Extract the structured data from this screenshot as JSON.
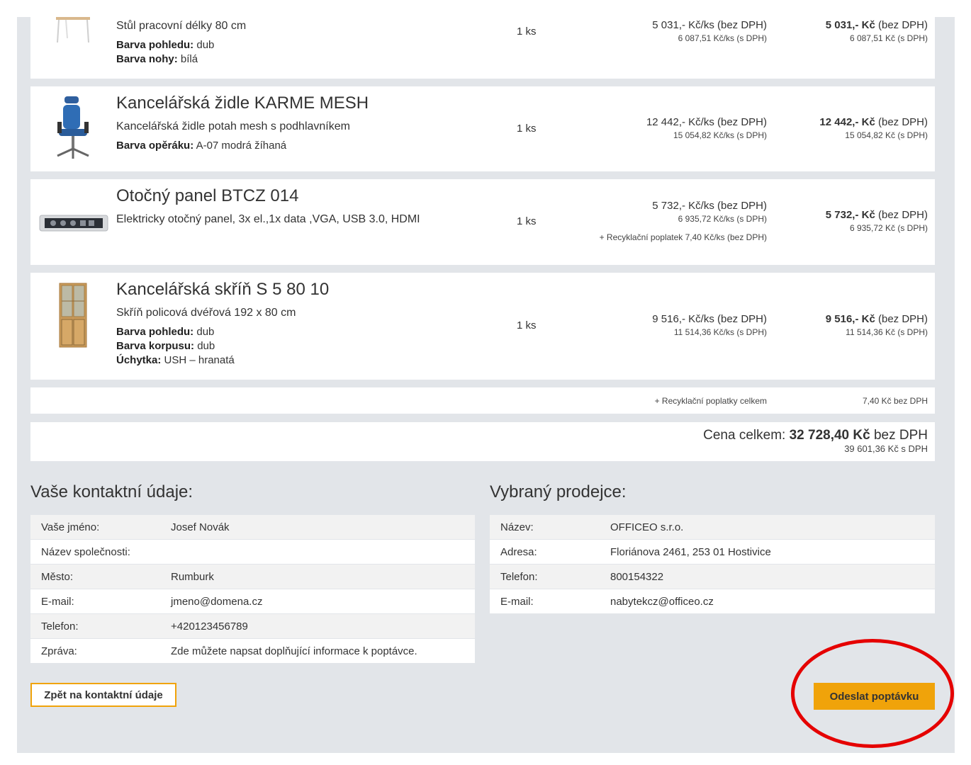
{
  "products": [
    {
      "title": "",
      "desc": "Stůl pracovní délky 80 cm",
      "attrs": [
        {
          "label": "Barva pohledu:",
          "value": "dub"
        },
        {
          "label": "Barva nohy:",
          "value": "bílá"
        }
      ],
      "qty": "1 ks",
      "unit_price": "5 031,- Kč/ks (bez DPH)",
      "unit_price_vat": "6 087,51 Kč/ks (s DPH)",
      "total_bold": "5 031,- Kč",
      "total_suffix": " (bez DPH)",
      "total_vat": "6 087,51 Kč (s DPH)"
    },
    {
      "title": "Kancelářská židle KARME MESH",
      "desc": "Kancelářská židle potah mesh s podhlavníkem",
      "attrs": [
        {
          "label": "Barva opěráku:",
          "value": "A-07 modrá žíhaná"
        }
      ],
      "qty": "1 ks",
      "unit_price": "12 442,- Kč/ks (bez DPH)",
      "unit_price_vat": "15 054,82 Kč/ks (s DPH)",
      "total_bold": "12 442,- Kč",
      "total_suffix": " (bez DPH)",
      "total_vat": "15 054,82 Kč (s DPH)"
    },
    {
      "title": "Otočný panel BTCZ 014",
      "desc": "Elektricky otočný panel, 3x el.,1x data ,VGA, USB 3.0, HDMI",
      "attrs": [],
      "qty": "1 ks",
      "unit_price": "5 732,- Kč/ks (bez DPH)",
      "unit_price_vat": "6 935,72 Kč/ks (s DPH)",
      "recycling": "+ Recyklační poplatek 7,40 Kč/ks (bez DPH)",
      "total_bold": "5 732,- Kč",
      "total_suffix": " (bez DPH)",
      "total_vat": "6 935,72 Kč (s DPH)"
    },
    {
      "title": "Kancelářská skříň S 5 80 10",
      "desc": "Skříň policová dvéřová 192 x 80 cm",
      "attrs": [
        {
          "label": "Barva pohledu:",
          "value": "dub"
        },
        {
          "label": "Barva korpusu:",
          "value": "dub"
        },
        {
          "label": "Úchytka:",
          "value": "USH – hranatá"
        }
      ],
      "qty": "1 ks",
      "unit_price": "9 516,- Kč/ks (bez DPH)",
      "unit_price_vat": "11 514,36 Kč/ks (s DPH)",
      "total_bold": "9 516,- Kč",
      "total_suffix": " (bez DPH)",
      "total_vat": "11 514,36 Kč (s DPH)"
    }
  ],
  "recycling_total": {
    "label": "+ Recyklační poplatky celkem",
    "value": "7,40 Kč bez DPH"
  },
  "grand_total": {
    "prefix": "Cena celkem: ",
    "bold": "32 728,40 Kč",
    "suffix": " bez DPH",
    "vat": "39 601,36 Kč s DPH"
  },
  "contact": {
    "title": "Vaše kontaktní údaje:",
    "rows": [
      {
        "label": "Vaše jméno:",
        "value": "Josef Novák"
      },
      {
        "label": "Název společnosti:",
        "value": ""
      },
      {
        "label": "Město:",
        "value": "Rumburk"
      },
      {
        "label": "E-mail:",
        "value": "jmeno@domena.cz"
      },
      {
        "label": "Telefon:",
        "value": "+420123456789"
      },
      {
        "label": "Zpráva:",
        "value": "Zde můžete napsat doplňující informace k poptávce."
      }
    ]
  },
  "seller": {
    "title": "Vybraný prodejce:",
    "rows": [
      {
        "label": "Název:",
        "value": "OFFICEO s.r.o."
      },
      {
        "label": "Adresa:",
        "value": "Floriánova 2461, 253 01 Hostivice"
      },
      {
        "label": "Telefon:",
        "value": "800154322"
      },
      {
        "label": "E-mail:",
        "value": "nabytekcz@officeo.cz"
      }
    ]
  },
  "buttons": {
    "back": "Zpět na kontaktní údaje",
    "submit": "Odeslat poptávku"
  },
  "colors": {
    "accent": "#f0a30a",
    "annotation": "#e50000",
    "background": "#e2e5e9"
  }
}
